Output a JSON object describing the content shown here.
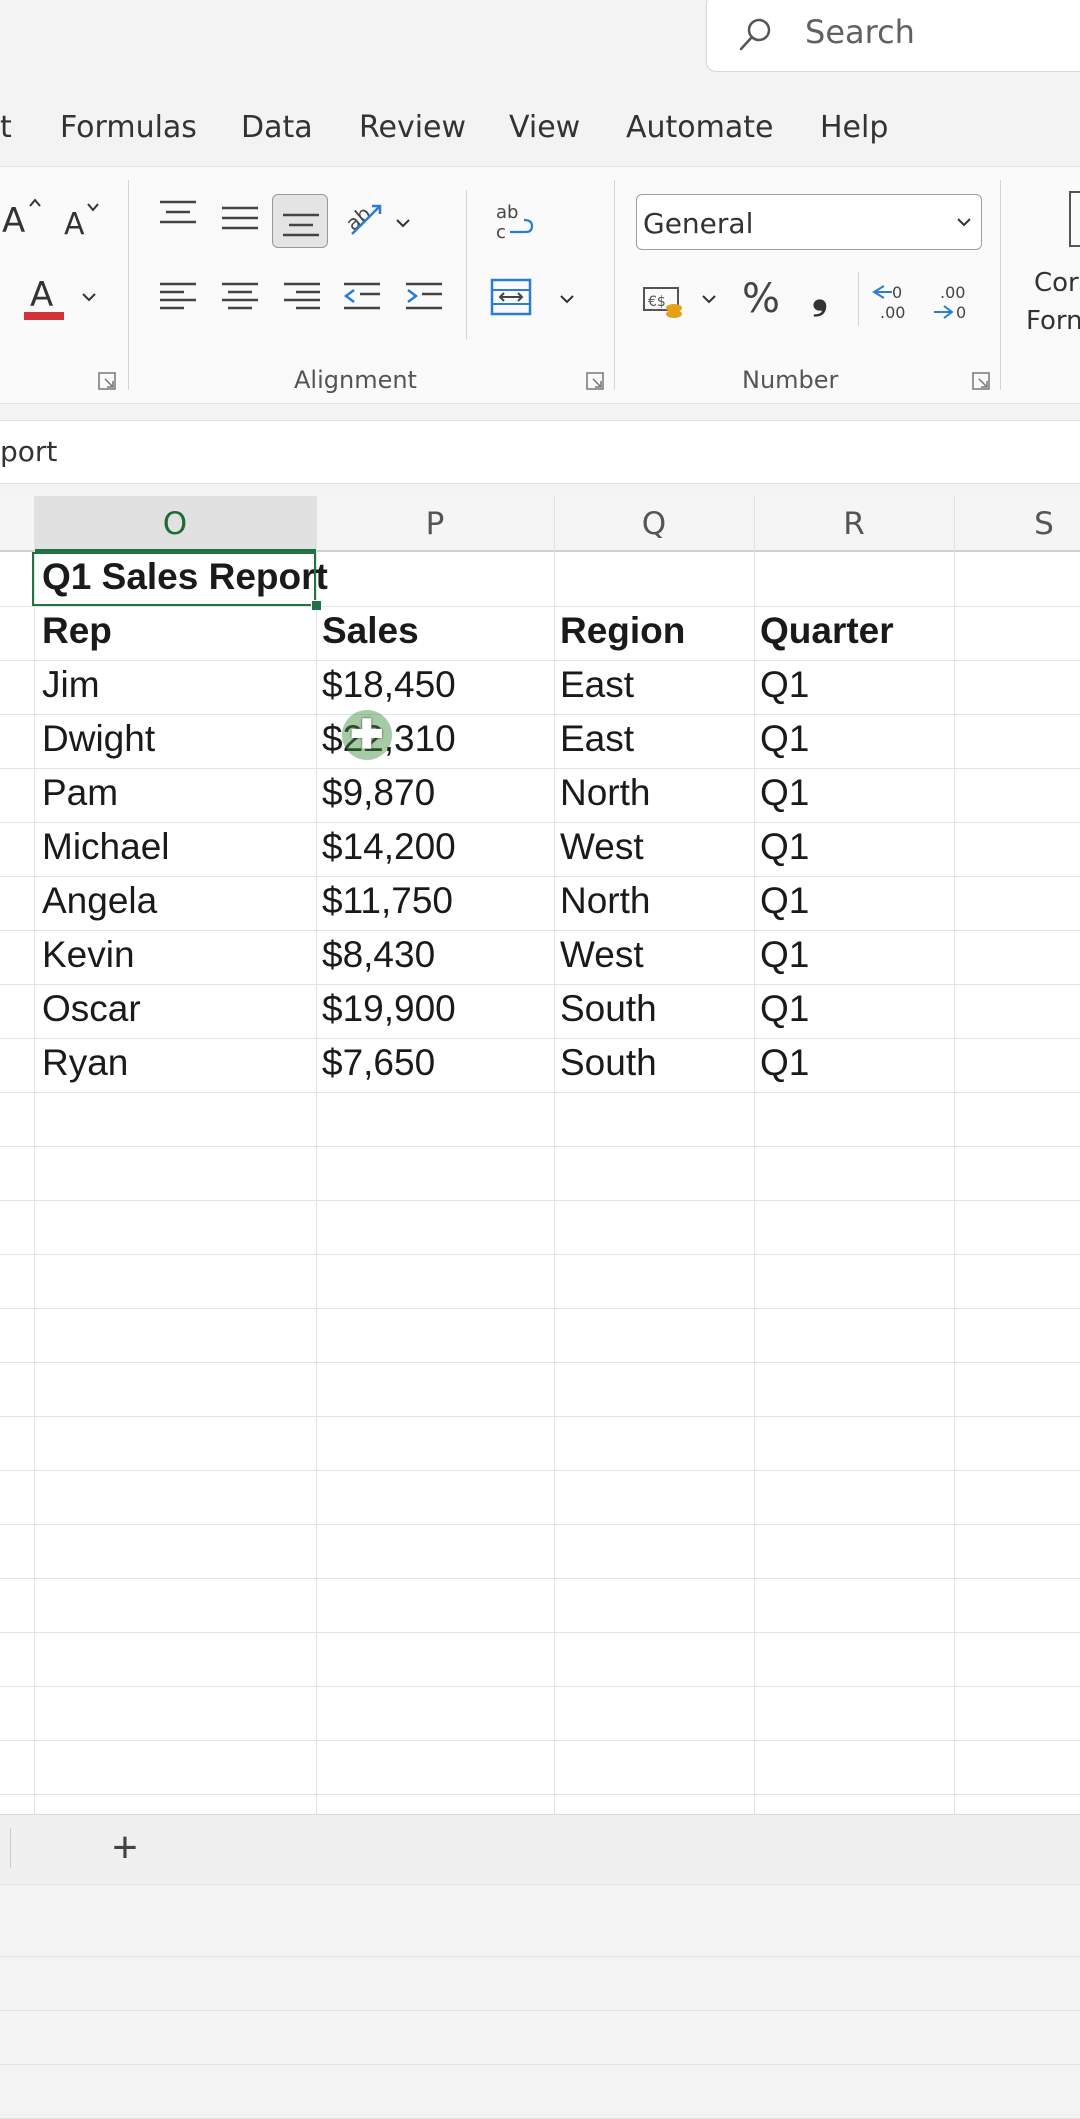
{
  "search": {
    "placeholder": "Search"
  },
  "tabs": [
    {
      "label": "t"
    },
    {
      "label": "Formulas"
    },
    {
      "label": "Data"
    },
    {
      "label": "Review"
    },
    {
      "label": "View"
    },
    {
      "label": "Automate"
    },
    {
      "label": "Help"
    }
  ],
  "ribbon": {
    "groups": {
      "alignment": "Alignment",
      "number": "Number"
    },
    "number_format": "General",
    "conditional_formatting_line1": "Cor",
    "conditional_formatting_line2": "Forn",
    "font_color": "#d13438",
    "percent_symbol": "%",
    "comma_symbol": "❟"
  },
  "formula_bar": {
    "text": "port"
  },
  "columns": [
    {
      "label": "O",
      "selected": true
    },
    {
      "label": "P"
    },
    {
      "label": "Q"
    },
    {
      "label": "R"
    },
    {
      "label": "S"
    }
  ],
  "sheet": {
    "title": "Q1 Sales Report",
    "headers": [
      "Rep",
      "Sales",
      "Region",
      "Quarter"
    ],
    "rows": [
      [
        "Jim",
        "$18,450",
        "East",
        "Q1"
      ],
      [
        "Dwight",
        "$22,310",
        "East",
        "Q1"
      ],
      [
        "Pam",
        "$9,870",
        "North",
        "Q1"
      ],
      [
        "Michael",
        "$14,200",
        "West",
        "Q1"
      ],
      [
        "Angela",
        "$11,750",
        "North",
        "Q1"
      ],
      [
        "Kevin",
        "$8,430",
        "West",
        "Q1"
      ],
      [
        "Oscar",
        "$19,900",
        "South",
        "Q1"
      ],
      [
        "Ryan",
        "$7,650",
        "South",
        "Q1"
      ]
    ]
  },
  "add_sheet": "+",
  "accent_color": "#217346"
}
